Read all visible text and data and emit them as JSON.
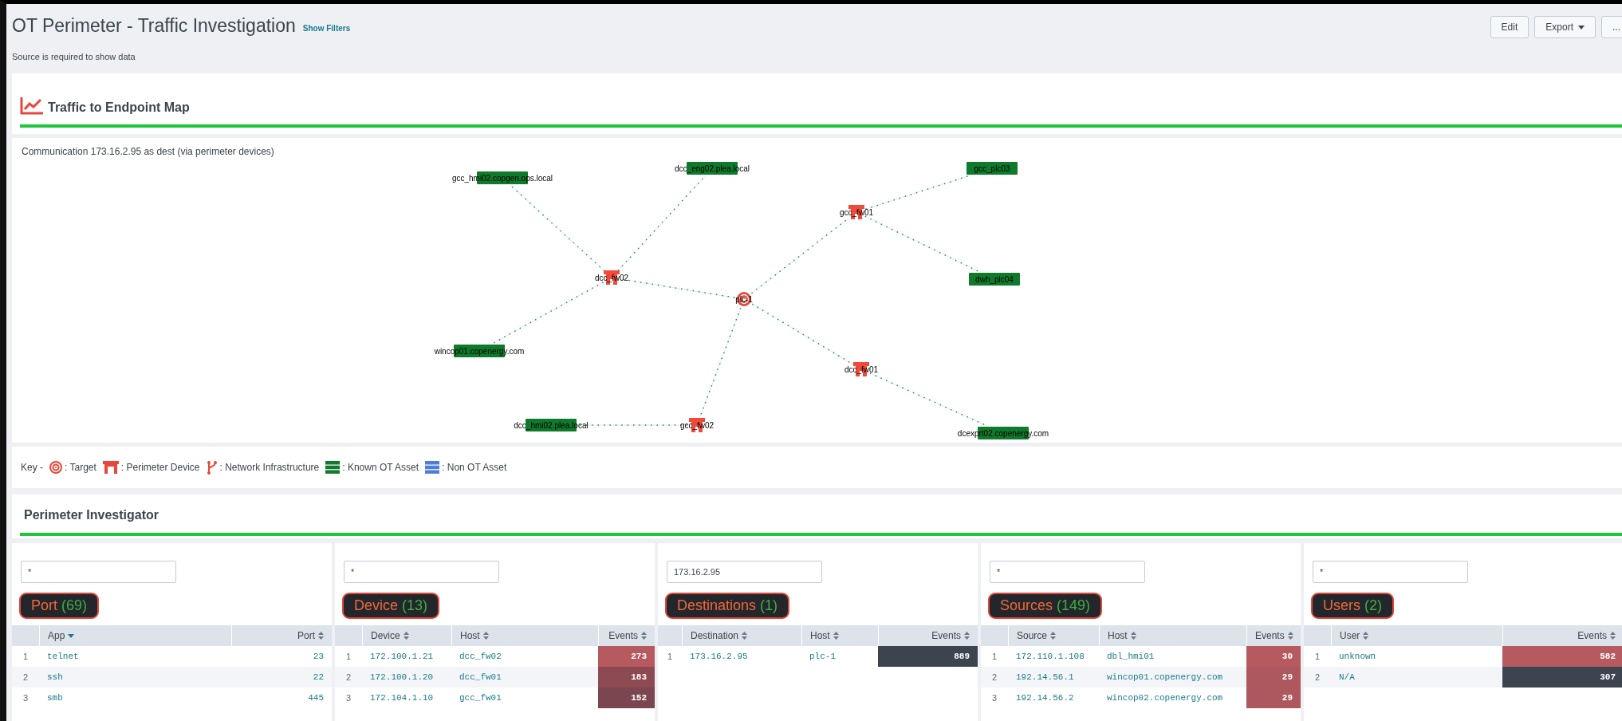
{
  "header": {
    "title": "OT Perimeter - Traffic Investigation",
    "filters_link": "Show Filters",
    "message": "Source is required to show data",
    "buttons": [
      {
        "label": "Edit",
        "kind": "plain"
      },
      {
        "label": "Export",
        "kind": "dropdown"
      },
      {
        "label": "...",
        "kind": "plain"
      }
    ]
  },
  "map_panel": {
    "title": "Traffic to Endpoint Map",
    "caption": "Communication 173.16.2.95 as dest (via perimeter devices)",
    "graph": {
      "label": "plc-1",
      "kind": "target",
      "children": [
        {
          "label": "dcc_fw02",
          "kind": "perimeter",
          "children": [
            {
              "label": "gcc_hmi02.copgen.ops.local",
              "kind": "asset"
            },
            {
              "label": "dcc_eng02.plea.local",
              "kind": "asset"
            },
            {
              "label": "wincop01.copenergy.com",
              "kind": "asset"
            }
          ]
        },
        {
          "label": "gcc_fw01",
          "kind": "perimeter",
          "children": [
            {
              "label": "gcc_plc03",
              "kind": "asset"
            },
            {
              "label": "dwh_plc04",
              "kind": "asset"
            }
          ]
        },
        {
          "label": "dcc_fw01",
          "kind": "perimeter",
          "children": [
            {
              "label": "dcexprt02.copenergy.com",
              "kind": "asset"
            }
          ]
        },
        {
          "label": "gcc_fw02",
          "kind": "perimeter",
          "children": [
            {
              "label": "dcc_hmi02.plea.local",
              "kind": "asset"
            }
          ]
        }
      ]
    }
  },
  "key": {
    "label": "Key -",
    "items": [
      {
        "kind": "target",
        "label": ": Target"
      },
      {
        "kind": "perimeter",
        "label": ": Perimeter Device"
      },
      {
        "kind": "network",
        "label": ": Network Infrastructure"
      },
      {
        "kind": "known",
        "label": ": Known OT Asset"
      },
      {
        "kind": "nonot",
        "label": ": Non OT Asset"
      }
    ]
  },
  "investigator": {
    "title": "Perimeter Investigator",
    "panels": [
      {
        "filter": "*",
        "title": "Port",
        "count": "(69)",
        "columns": [
          {
            "label": "App",
            "sorted": true
          },
          {
            "label": "Port",
            "sorted": false
          }
        ],
        "rows": [
          {
            "number": "1",
            "cells": [
              {
                "kind": "text",
                "text": "telnet"
              },
              {
                "kind": "text",
                "text": "23"
              }
            ]
          },
          {
            "number": "2",
            "cells": [
              {
                "kind": "text",
                "text": "ssh"
              },
              {
                "kind": "text",
                "text": "22"
              }
            ]
          },
          {
            "number": "3",
            "cells": [
              {
                "kind": "text",
                "text": "smb"
              },
              {
                "kind": "text",
                "text": "445"
              }
            ]
          }
        ]
      },
      {
        "filter": "*",
        "title": "Device",
        "count": "(13)",
        "columns": [
          {
            "label": "Device",
            "sorted": false
          },
          {
            "label": "Host",
            "sorted": false
          },
          {
            "label": "Events",
            "sorted": false
          }
        ],
        "rows": [
          {
            "number": "1",
            "cells": [
              {
                "kind": "text",
                "text": "172.100.1.21"
              },
              {
                "kind": "text",
                "text": "dcc_fw02"
              },
              {
                "kind": "heat",
                "text": "273",
                "color": "#b65a5f"
              }
            ]
          },
          {
            "number": "2",
            "cells": [
              {
                "kind": "text",
                "text": "172.100.1.20"
              },
              {
                "kind": "text",
                "text": "dcc_fw01"
              },
              {
                "kind": "heat",
                "text": "183",
                "color": "#8e4a53"
              }
            ]
          },
          {
            "number": "3",
            "cells": [
              {
                "kind": "text",
                "text": "172.104.1.10"
              },
              {
                "kind": "text",
                "text": "gcc_fw01"
              },
              {
                "kind": "heat",
                "text": "152",
                "color": "#7c4651"
              }
            ]
          }
        ]
      },
      {
        "filter": "173.16.2.95",
        "title": "Destinations",
        "count": "(1)",
        "columns": [
          {
            "label": "Destination",
            "sorted": false
          },
          {
            "label": "Host",
            "sorted": false
          },
          {
            "label": "Events",
            "sorted": false
          }
        ],
        "rows": [
          {
            "number": "1",
            "cells": [
              {
                "kind": "text",
                "text": "173.16.2.95"
              },
              {
                "kind": "text",
                "text": "plc-1"
              },
              {
                "kind": "heat",
                "text": "889",
                "color": "#3c444f"
              }
            ]
          }
        ]
      },
      {
        "filter": "*",
        "title": "Sources",
        "count": "(149)",
        "columns": [
          {
            "label": "Source",
            "sorted": false
          },
          {
            "label": "Host",
            "sorted": false
          },
          {
            "label": "Events",
            "sorted": false
          }
        ],
        "rows": [
          {
            "number": "1",
            "cells": [
              {
                "kind": "text",
                "text": "172.110.1.108"
              },
              {
                "kind": "text",
                "text": "dbl_hmi01"
              },
              {
                "kind": "heat",
                "text": "30",
                "color": "#b65a5f"
              }
            ]
          },
          {
            "number": "2",
            "cells": [
              {
                "kind": "text",
                "text": "192.14.56.1"
              },
              {
                "kind": "text",
                "text": "wincop01.copenergy.com"
              },
              {
                "kind": "heat",
                "text": "29",
                "color": "#ad585e"
              }
            ]
          },
          {
            "number": "3",
            "cells": [
              {
                "kind": "text",
                "text": "192.14.56.2"
              },
              {
                "kind": "text",
                "text": "wincop02.copenergy.com"
              },
              {
                "kind": "heat",
                "text": "29",
                "color": "#ad585e"
              }
            ]
          }
        ]
      },
      {
        "filter": "*",
        "title": "Users",
        "count": "(2)",
        "columns": [
          {
            "label": "User",
            "sorted": false
          },
          {
            "label": "Events",
            "sorted": false
          }
        ],
        "rows": [
          {
            "number": "1",
            "cells": [
              {
                "kind": "text",
                "text": "unknown"
              },
              {
                "kind": "heat",
                "text": "582",
                "color": "#b65a5f"
              }
            ]
          },
          {
            "number": "2",
            "cells": [
              {
                "kind": "text",
                "text": "N/A"
              },
              {
                "kind": "heat",
                "text": "307",
                "color": "#3c444f"
              }
            ]
          }
        ]
      }
    ]
  }
}
